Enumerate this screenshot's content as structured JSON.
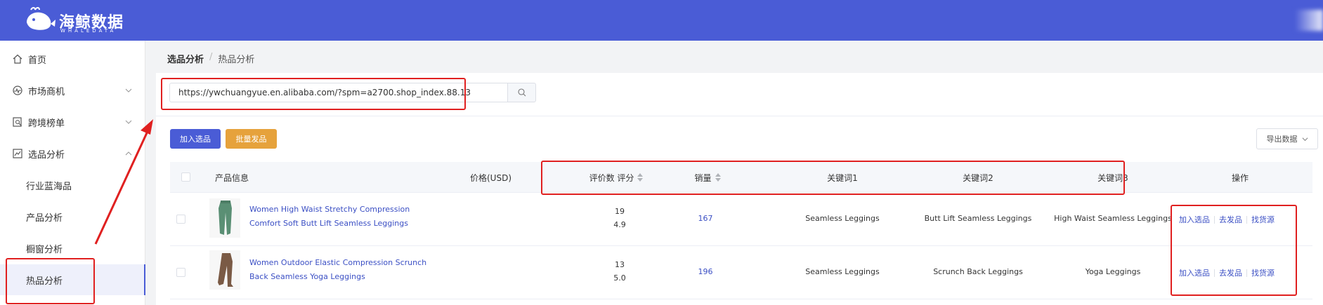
{
  "brand": {
    "name": "海鲸数据",
    "sub": "WHALEDATA",
    "color": "#4a5cd6"
  },
  "sidebar": {
    "items": [
      {
        "label": "首页",
        "icon": "home-icon"
      },
      {
        "label": "市场商机",
        "icon": "pulse-icon",
        "expandable": true
      },
      {
        "label": "跨境榜单",
        "icon": "search-doc-icon",
        "expandable": true
      },
      {
        "label": "选品分析",
        "icon": "chart-icon",
        "expandable": true,
        "expanded": true
      },
      {
        "label": "行业蓝海品"
      },
      {
        "label": "产品分析"
      },
      {
        "label": "橱窗分析"
      },
      {
        "label": "热品分析",
        "active": true
      }
    ]
  },
  "breadcrumb": {
    "first": "选品分析",
    "separator": "/",
    "second": "热品分析"
  },
  "search": {
    "value": "https://ywchuangyue.en.alibaba.com/?spm=a2700.shop_index.88.13"
  },
  "toolbar": {
    "add_label": "加入选品",
    "batch_label": "批量发品",
    "export_label": "导出数据"
  },
  "table": {
    "headers": {
      "product": "产品信息",
      "price": "价格(USD)",
      "reviews": "评价数 评分",
      "sales": "销量",
      "kw1": "关键词1",
      "kw2": "关键词2",
      "kw3": "关键词3",
      "ops": "操作"
    },
    "rows": [
      {
        "name": "Women High Waist Stretchy Compression Comfort Soft Butt Lift Seamless Leggings",
        "reviews": "19",
        "rating": "4.9",
        "sales": "167",
        "kw1": "Seamless Leggings",
        "kw2": "Butt Lift Seamless Leggings",
        "kw3": "High Waist Seamless Leggings",
        "thumb_color": "#5a8f74"
      },
      {
        "name": "Women Outdoor Elastic Compression Scrunch Back Seamless Yoga Leggings",
        "reviews": "13",
        "rating": "5.0",
        "sales": "196",
        "kw1": "Seamless Leggings",
        "kw2": "Scrunch Back Leggings",
        "kw3": "Yoga Leggings",
        "thumb_color": "#7a5a45"
      }
    ],
    "actions": {
      "add": "加入选品",
      "publish": "去发品",
      "source": "找货源"
    }
  },
  "annotation_color": "#e02020"
}
